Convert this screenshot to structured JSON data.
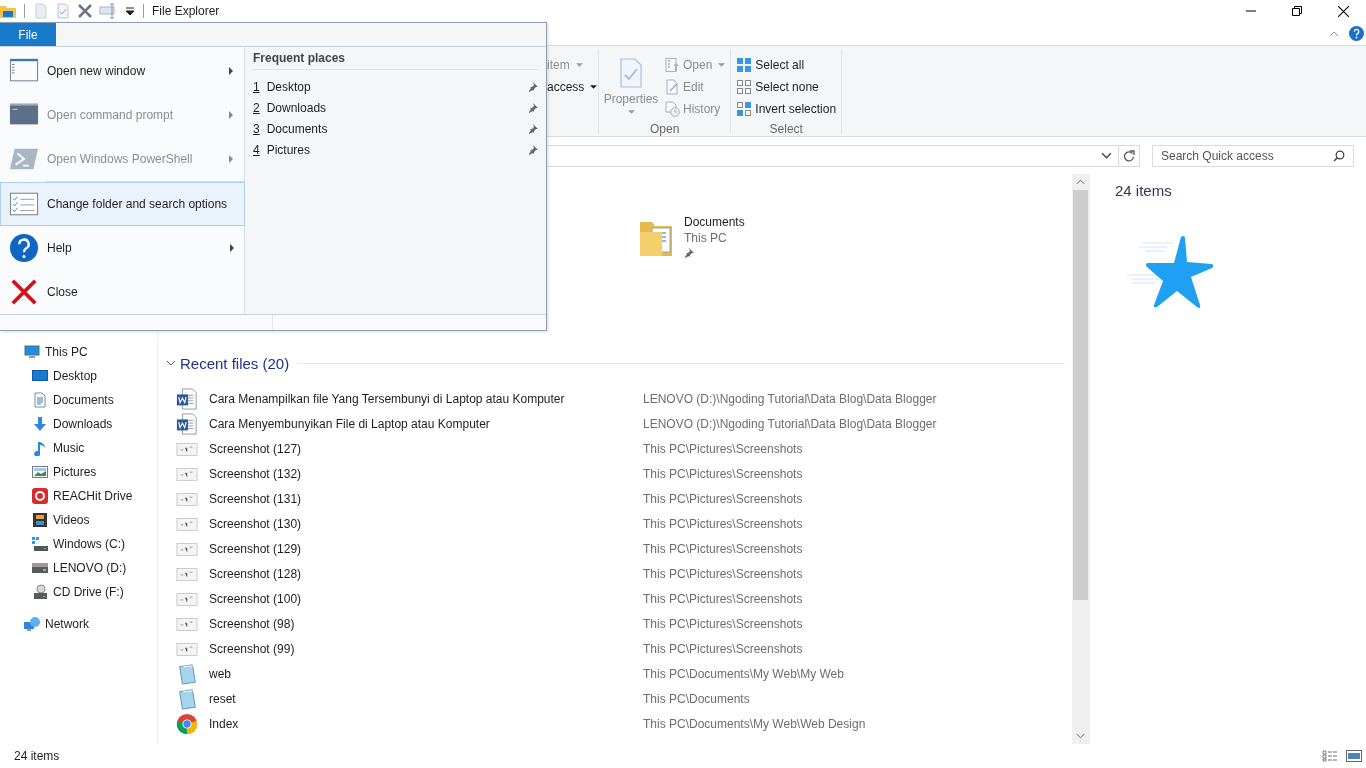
{
  "title_bar": {
    "title": "File Explorer"
  },
  "file_menu": {
    "tab": {
      "label": "File",
      "selected": true
    },
    "sections": [
      [
        {
          "kind": "new-window",
          "label": "Open new window",
          "submenu": true,
          "disabled": false,
          "selected": false
        },
        {
          "kind": "command-prompt",
          "label": "Open command prompt",
          "submenu": true,
          "disabled": true,
          "selected": false
        },
        {
          "kind": "powershell",
          "label": "Open Windows PowerShell",
          "submenu": true,
          "disabled": true,
          "selected": false
        }
      ],
      [
        {
          "kind": "options",
          "label": "Change folder and search options",
          "submenu": false,
          "disabled": false,
          "selected": true
        },
        {
          "kind": "help",
          "label": "Help",
          "submenu": true,
          "disabled": false,
          "selected": false
        },
        {
          "kind": "close",
          "label": "Close",
          "submenu": false,
          "disabled": false,
          "selected": false
        }
      ]
    ],
    "frequent_places": {
      "title": "Frequent places",
      "items": [
        {
          "number": "1",
          "name": "Desktop",
          "pinned": true
        },
        {
          "number": "2",
          "name": "Downloads",
          "pinned": true
        },
        {
          "number": "3",
          "name": "Documents",
          "pinned": true
        },
        {
          "number": "4",
          "name": "Pictures",
          "pinned": true
        }
      ]
    }
  },
  "ribbon": {
    "groups": [
      {
        "commands": [
          {
            "kind": "text",
            "label": "item",
            "disabled": true,
            "dropdown": true
          },
          {
            "kind": "text",
            "label": "access",
            "disabled": false,
            "dropdown": true
          }
        ]
      },
      {
        "label": "Open",
        "commands": [
          {
            "kind": "properties",
            "label": "Properties",
            "disabled": true,
            "dropdown": true
          },
          {
            "kind": "open",
            "label": "Open",
            "disabled": true,
            "dropdown": true
          },
          {
            "kind": "edit",
            "label": "Edit",
            "disabled": true,
            "dropdown": false
          },
          {
            "kind": "history",
            "label": "History",
            "disabled": true,
            "dropdown": false
          }
        ]
      },
      {
        "label": "Select",
        "commands": [
          {
            "kind": "select-all",
            "label": "Select all",
            "disabled": false,
            "dropdown": false
          },
          {
            "kind": "select-none",
            "label": "Select none",
            "disabled": false,
            "dropdown": false
          },
          {
            "kind": "invert-selection",
            "label": "Invert selection",
            "disabled": false,
            "dropdown": false
          }
        ]
      }
    ]
  },
  "search": {
    "placeholder": "Search Quick access"
  },
  "navigation": [
    {
      "label": "This PC",
      "kind": "computer",
      "children": [
        {
          "label": "Desktop",
          "kind": "desktop"
        },
        {
          "label": "Documents",
          "kind": "documents"
        },
        {
          "label": "Downloads",
          "kind": "downloads"
        },
        {
          "label": "Music",
          "kind": "music"
        },
        {
          "label": "Pictures",
          "kind": "pictures"
        },
        {
          "label": "REACHit Drive",
          "kind": "app"
        },
        {
          "label": "Videos",
          "kind": "videos"
        },
        {
          "label": "Windows (C:)",
          "kind": "system-drive"
        },
        {
          "label": "LENOVO (D:)",
          "kind": "drive"
        },
        {
          "label": "CD Drive (F:)",
          "kind": "cd-drive"
        }
      ]
    },
    {
      "label": "Network",
      "kind": "network"
    }
  ],
  "frequent_folders": [
    {
      "name": "Documents",
      "location": "This PC",
      "pinned": true
    }
  ],
  "recent_files": {
    "title": "Recent files (20)",
    "expanded": true,
    "items": [
      {
        "kind": "word",
        "name": "Cara Menampilkan file Yang Tersembunyi di Laptop atau Komputer",
        "location": "LENOVO (D:)\\Ngoding Tutorial\\Data Blog\\Data Blogger"
      },
      {
        "kind": "word",
        "name": "Cara Menyembunyikan File di Laptop atau Komputer",
        "location": "LENOVO (D:)\\Ngoding Tutorial\\Data Blog\\Data Blogger"
      },
      {
        "kind": "image",
        "name": "Screenshot (127)",
        "location": "This PC\\Pictures\\Screenshots"
      },
      {
        "kind": "image",
        "name": "Screenshot (132)",
        "location": "This PC\\Pictures\\Screenshots"
      },
      {
        "kind": "image",
        "name": "Screenshot (131)",
        "location": "This PC\\Pictures\\Screenshots"
      },
      {
        "kind": "image",
        "name": "Screenshot (130)",
        "location": "This PC\\Pictures\\Screenshots"
      },
      {
        "kind": "image",
        "name": "Screenshot (129)",
        "location": "This PC\\Pictures\\Screenshots"
      },
      {
        "kind": "image",
        "name": "Screenshot (128)",
        "location": "This PC\\Pictures\\Screenshots"
      },
      {
        "kind": "image",
        "name": "Screenshot (100)",
        "location": "This PC\\Pictures\\Screenshots"
      },
      {
        "kind": "image",
        "name": "Screenshot (98)",
        "location": "This PC\\Pictures\\Screenshots"
      },
      {
        "kind": "image",
        "name": "Screenshot (99)",
        "location": "This PC\\Pictures\\Screenshots"
      },
      {
        "kind": "text",
        "name": "web",
        "location": "This PC\\Documents\\My Web\\My Web"
      },
      {
        "kind": "text",
        "name": "reset",
        "location": "This PC\\Documents"
      },
      {
        "kind": "browser",
        "name": "Index",
        "location": "This PC\\Documents\\My Web\\Web Design"
      }
    ]
  },
  "details_pane": {
    "summary": "24 items"
  },
  "status_bar": {
    "count": "24 items"
  }
}
